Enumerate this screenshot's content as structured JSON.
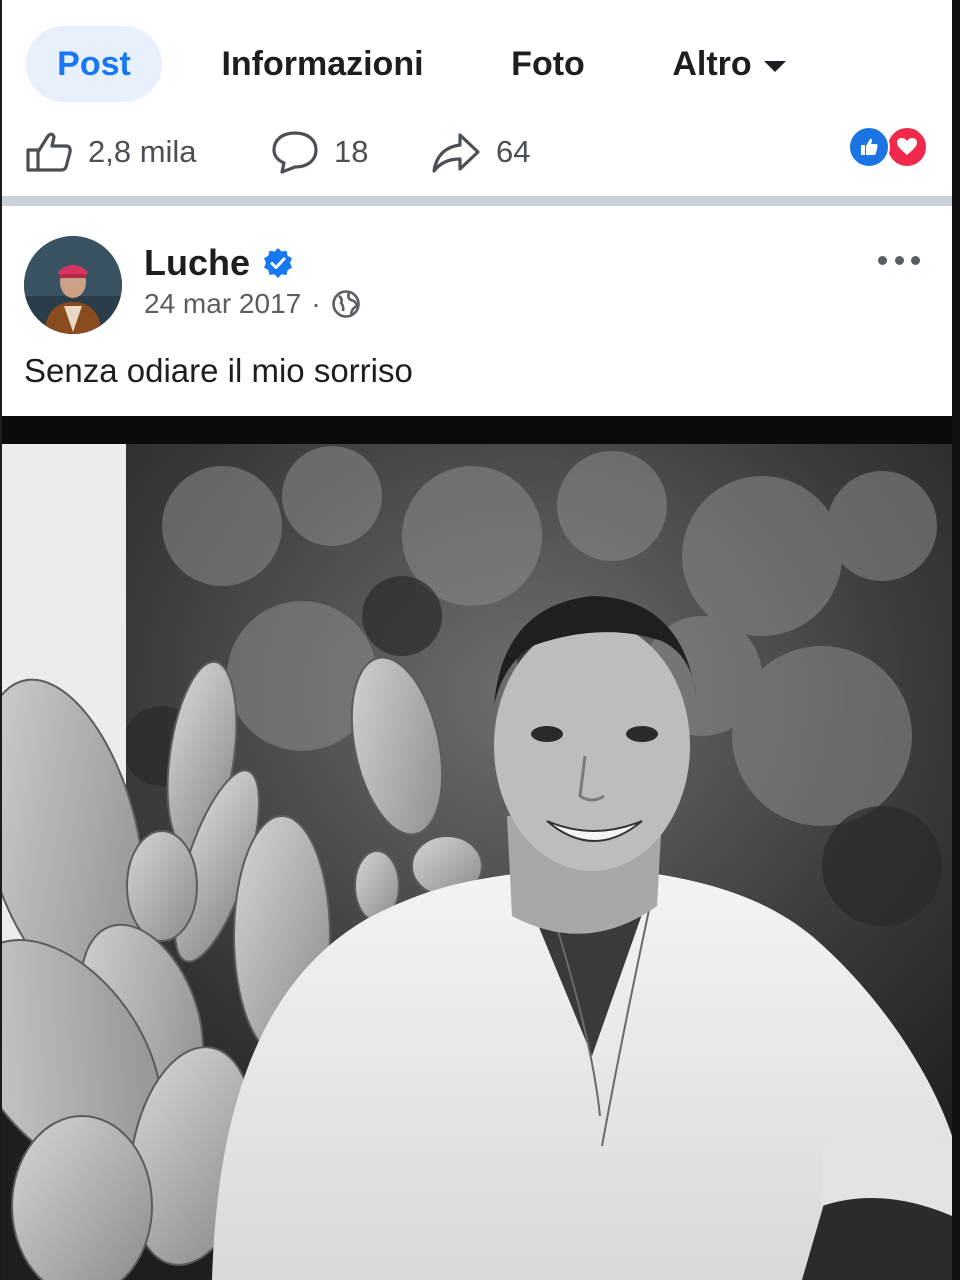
{
  "tabs": [
    {
      "label": "Post",
      "active": true
    },
    {
      "label": "Informazioni",
      "active": false
    },
    {
      "label": "Foto",
      "active": false
    },
    {
      "label": "Altro",
      "active": false,
      "icon": "caret-down-icon"
    }
  ],
  "stats": {
    "likes": "2,8 mila",
    "comments": "18",
    "shares": "64"
  },
  "reactions": [
    "like-reaction-icon",
    "love-reaction-icon"
  ],
  "post": {
    "author": "Luche",
    "verified": true,
    "date": "24 mar 2017",
    "separator": "·",
    "audience_icon": "globe-icon",
    "caption": "Senza odiare il mio sorriso"
  },
  "colors": {
    "accent": "#1877f2",
    "active_tab_bg": "#e7f0fb",
    "love": "#f0284a",
    "divider": "#c9d1db"
  }
}
